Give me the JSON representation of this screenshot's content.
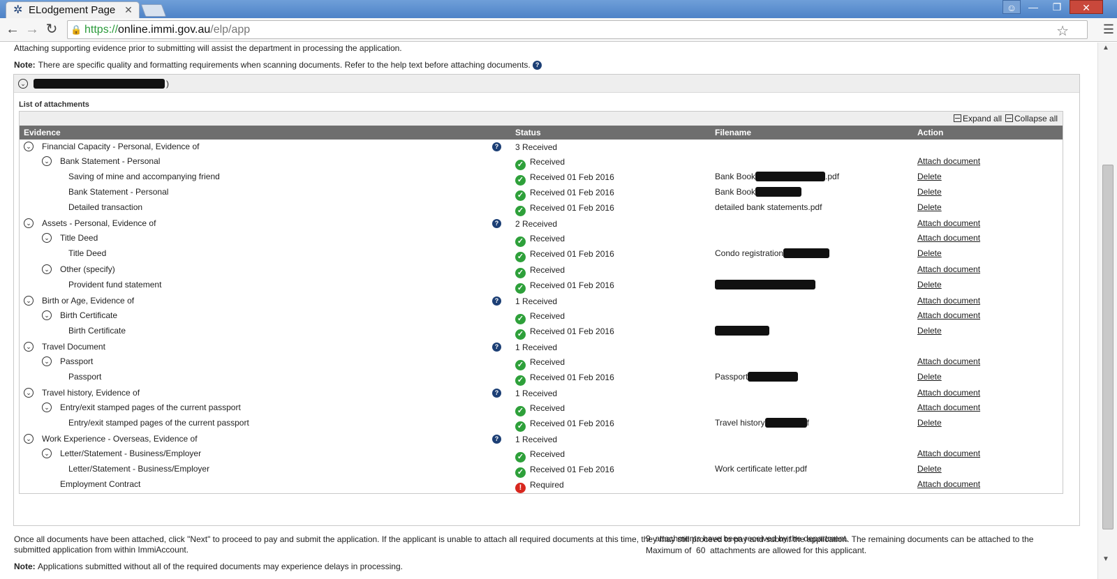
{
  "browser": {
    "tab_title": "ELodgement Page",
    "tab_close": "✕",
    "url_scheme": "https://",
    "url_host": "online.immi.gov.au",
    "url_path": "/elp/app"
  },
  "page": {
    "intro": "Attaching supporting evidence prior to submitting will assist the department in processing the application.",
    "note_label": "Note:",
    "note_text": "There are specific quality and formatting requirements when scanning documents. Refer to the help text before attaching documents.",
    "applicant_suffix": ")",
    "list_label": "List of attachments",
    "expand_all": "Expand all",
    "collapse_all": "Collapse all",
    "columns": {
      "evidence": "Evidence",
      "status": "Status",
      "filename": "Filename",
      "action": "Action"
    },
    "rows": [
      {
        "label": "Financial Capacity - Personal, Evidence of",
        "status": "3 Received",
        "filename": "",
        "action": ""
      },
      {
        "label": "Bank Statement - Personal",
        "status": "Received",
        "filename": "",
        "action": "Attach document"
      },
      {
        "label": "Saving of mine and accompanying friend",
        "status": "Received 01 Feb 2016",
        "filename": "Bank Book",
        "filename_suffix": ".pdf",
        "action": "Delete"
      },
      {
        "label": "Bank Statement - Personal",
        "status": "Received 01 Feb 2016",
        "filename": "Bank Book",
        "filename_suffix": "",
        "action": "Delete"
      },
      {
        "label": "Detailed transaction",
        "status": "Received 01 Feb 2016",
        "filename": "detailed bank statements.pdf",
        "action": "Delete"
      },
      {
        "label": "Assets - Personal, Evidence of",
        "status": "2 Received",
        "filename": "",
        "action": "Attach document"
      },
      {
        "label": "Title Deed",
        "status": "Received",
        "filename": "",
        "action": "Attach document"
      },
      {
        "label": "Title Deed",
        "status": "Received 01 Feb 2016",
        "filename": "Condo registration",
        "filename_suffix": "",
        "action": "Delete"
      },
      {
        "label": "Other (specify)",
        "status": "Received",
        "filename": "",
        "action": "Attach document"
      },
      {
        "label": "Provident fund statement",
        "status": "Received 01 Feb 2016",
        "filename": "",
        "action": "Delete"
      },
      {
        "label": "Birth or Age, Evidence of",
        "status": "1 Received",
        "filename": "",
        "action": "Attach document"
      },
      {
        "label": "Birth Certificate",
        "status": "Received",
        "filename": "",
        "action": "Attach document"
      },
      {
        "label": "Birth Certificate",
        "status": "Received 01 Feb 2016",
        "filename": "",
        "action": "Delete"
      },
      {
        "label": "Travel Document",
        "status": "1 Received",
        "filename": "",
        "action": ""
      },
      {
        "label": "Passport",
        "status": "Received",
        "filename": "",
        "action": "Attach document"
      },
      {
        "label": "Passport",
        "status": "Received 01 Feb 2016",
        "filename": "Passport",
        "filename_suffix": "",
        "action": "Delete"
      },
      {
        "label": "Travel history, Evidence of",
        "status": "1 Received",
        "filename": "",
        "action": "Attach document"
      },
      {
        "label": "Entry/exit stamped pages of the current passport",
        "status": "Received",
        "filename": "",
        "action": "Attach document"
      },
      {
        "label": "Entry/exit stamped pages of the current passport",
        "status": "Received 01 Feb 2016",
        "filename": "Travel history",
        "filename_suffix": "f",
        "action": "Delete"
      },
      {
        "label": "Work Experience - Overseas, Evidence of",
        "status": "1 Received",
        "filename": "",
        "action": ""
      },
      {
        "label": "Letter/Statement - Business/Employer",
        "status": "Received",
        "filename": "",
        "action": "Attach document"
      },
      {
        "label": "Letter/Statement - Business/Employer",
        "status": "Received 01 Feb 2016",
        "filename": "Work certificate letter.pdf",
        "action": "Delete"
      },
      {
        "label": "Employment Contract",
        "status": "Required",
        "filename": "",
        "action": "Attach document"
      }
    ],
    "summary_received_count": "9",
    "summary_received_text": "attachments have been received by the department.",
    "summary_max_prefix": "Maximum of",
    "summary_max_count": "60",
    "summary_max_text": "attachments are allowed for this applicant.",
    "footer": "Once all documents have been attached, click \"Next\" to proceed to pay and submit the application. If the applicant is unable to attach all required documents at this time, they may still proceed to pay and submit the application. The remaining documents can be attached to the submitted application from within ImmiAccount.",
    "footer_note_label": "Note:",
    "footer_note_text": "Applications submitted without all of the required documents may experience delays in processing."
  },
  "colors": {
    "header_bg": "#6e6e6e",
    "received_green": "#2ea03a",
    "required_red": "#d8271e",
    "help_blue": "#1c3f75"
  }
}
